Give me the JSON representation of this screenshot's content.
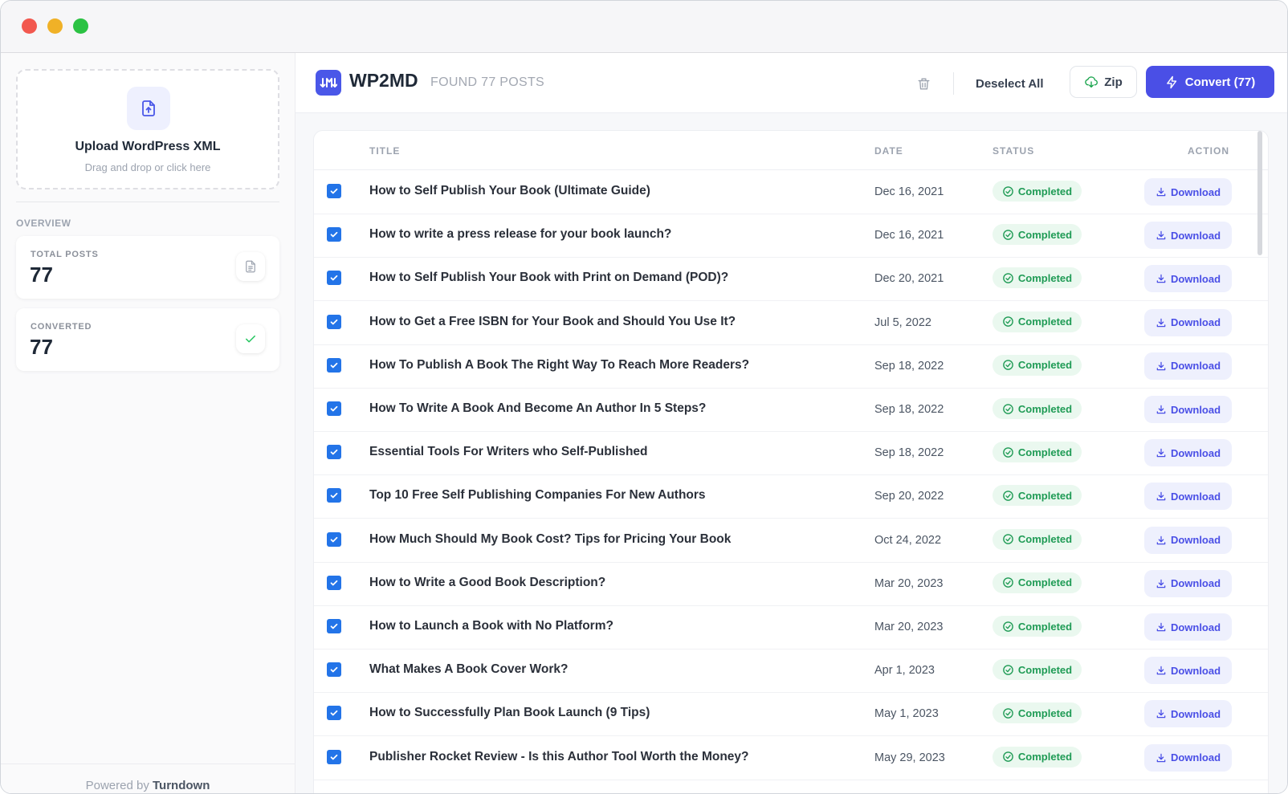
{
  "sidebar": {
    "upload_title": "Upload WordPress XML",
    "upload_subtitle": "Drag and drop or click here",
    "overview_label": "OVERVIEW",
    "stats": [
      {
        "label": "TOTAL POSTS",
        "value": "77",
        "icon": "document-icon"
      },
      {
        "label": "CONVERTED",
        "value": "77",
        "icon": "check-icon"
      }
    ],
    "footer_prefix": "Powered by",
    "footer_brand": "Turndown"
  },
  "header": {
    "brand": "WP2MD",
    "found": "FOUND 77 POSTS",
    "deselect_label": "Deselect All",
    "zip_label": "Zip",
    "convert_label": "Convert (77)"
  },
  "table": {
    "columns": {
      "title": "TITLE",
      "date": "DATE",
      "status": "STATUS",
      "action": "ACTION"
    },
    "rows": [
      {
        "title": "How to Self Publish Your Book (Ultimate Guide)",
        "date": "Dec 16, 2021",
        "status": "Completed",
        "action": "Download"
      },
      {
        "title": "How to write a press release for your book launch?",
        "date": "Dec 16, 2021",
        "status": "Completed",
        "action": "Download"
      },
      {
        "title": "How to Self Publish Your Book with Print on Demand (POD)?",
        "date": "Dec 20, 2021",
        "status": "Completed",
        "action": "Download"
      },
      {
        "title": "How to Get a Free ISBN for Your Book and Should You Use It?",
        "date": "Jul 5, 2022",
        "status": "Completed",
        "action": "Download"
      },
      {
        "title": "How To Publish A Book The Right Way To Reach More Readers?",
        "date": "Sep 18, 2022",
        "status": "Completed",
        "action": "Download"
      },
      {
        "title": "How To Write A Book And Become An Author In 5 Steps?",
        "date": "Sep 18, 2022",
        "status": "Completed",
        "action": "Download"
      },
      {
        "title": "Essential Tools For Writers who Self-Published",
        "date": "Sep 18, 2022",
        "status": "Completed",
        "action": "Download"
      },
      {
        "title": "Top 10 Free Self Publishing Companies For New Authors",
        "date": "Sep 20, 2022",
        "status": "Completed",
        "action": "Download"
      },
      {
        "title": "How Much Should My Book Cost? Tips for Pricing Your Book",
        "date": "Oct 24, 2022",
        "status": "Completed",
        "action": "Download"
      },
      {
        "title": "How to Write a Good Book Description?",
        "date": "Mar 20, 2023",
        "status": "Completed",
        "action": "Download"
      },
      {
        "title": "How to Launch a Book with No Platform?",
        "date": "Mar 20, 2023",
        "status": "Completed",
        "action": "Download"
      },
      {
        "title": "What Makes A Book Cover Work?",
        "date": "Apr 1, 2023",
        "status": "Completed",
        "action": "Download"
      },
      {
        "title": "How to Successfully Plan Book Launch (9 Tips)",
        "date": "May 1, 2023",
        "status": "Completed",
        "action": "Download"
      },
      {
        "title": "Publisher Rocket Review - Is this Author Tool Worth the Money?",
        "date": "May 29, 2023",
        "status": "Completed",
        "action": "Download"
      }
    ]
  },
  "colors": {
    "accent": "#4a4fe6",
    "checkbox": "#2374e8",
    "status_green": "#1f9b55",
    "status_bg": "#eaf8ef"
  }
}
